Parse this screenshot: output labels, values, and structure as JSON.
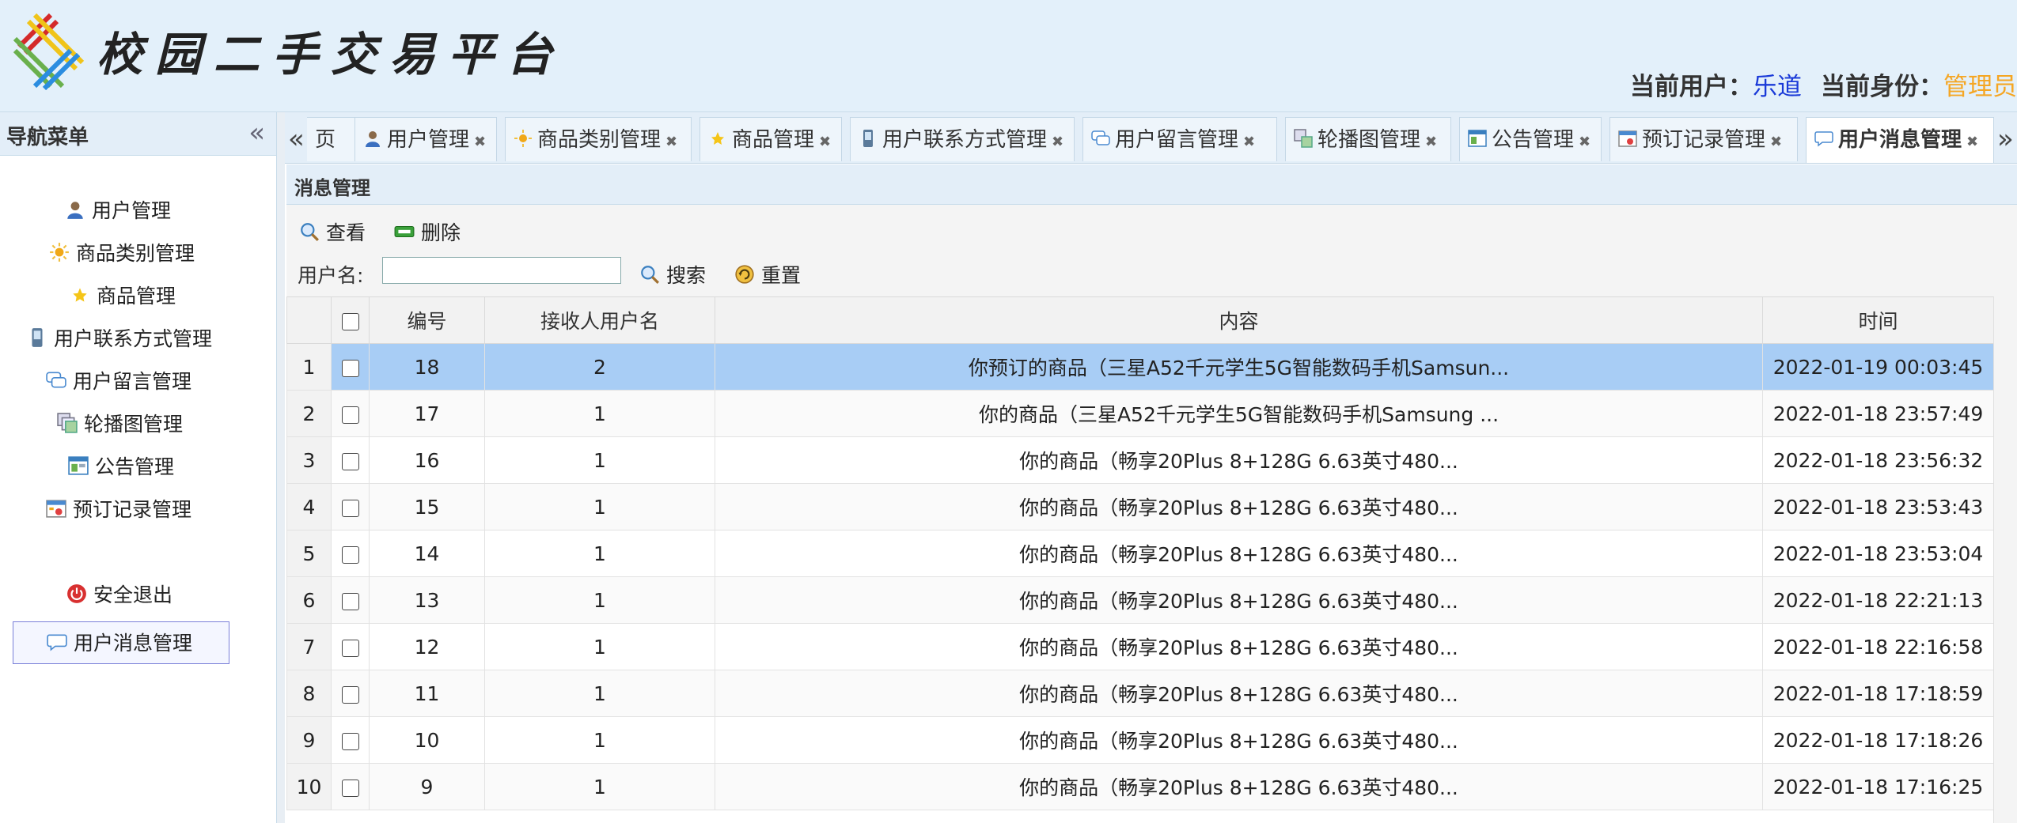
{
  "header": {
    "site_title": "校园二手交易平台",
    "current_user_label": "当前用户：",
    "current_user": "乐道",
    "current_role_label": "当前身份：",
    "current_role": "管理员"
  },
  "sidebar": {
    "title": "导航菜单",
    "items": [
      {
        "label": "用户管理",
        "icon": "user-icon"
      },
      {
        "label": "商品类别管理",
        "icon": "sun-icon"
      },
      {
        "label": "商品管理",
        "icon": "star-icon"
      },
      {
        "label": "用户联系方式管理",
        "icon": "phone-icon"
      },
      {
        "label": "用户留言管理",
        "icon": "chat-icon"
      },
      {
        "label": "轮播图管理",
        "icon": "images-icon"
      },
      {
        "label": "公告管理",
        "icon": "board-icon"
      },
      {
        "label": "预订记录管理",
        "icon": "calendar-icon"
      },
      {
        "label": "用户消息管理",
        "icon": "message-icon"
      },
      {
        "label": "安全退出",
        "icon": "power-icon"
      }
    ]
  },
  "tabs": [
    {
      "label": "页"
    },
    {
      "label": "用户管理"
    },
    {
      "label": "商品类别管理"
    },
    {
      "label": "商品管理"
    },
    {
      "label": "用户联系方式管理"
    },
    {
      "label": "用户留言管理"
    },
    {
      "label": "轮播图管理"
    },
    {
      "label": "公告管理"
    },
    {
      "label": "预订记录管理"
    },
    {
      "label": "用户消息管理"
    }
  ],
  "panel": {
    "title": "消息管理",
    "view_label": "查看",
    "delete_label": "删除",
    "username_label": "用户名:",
    "username_value": "",
    "search_label": "搜索",
    "reset_label": "重置"
  },
  "table": {
    "columns": [
      "编号",
      "接收人用户名",
      "内容",
      "时间"
    ],
    "rows": [
      {
        "n": "1",
        "id": "18",
        "receiver": "2",
        "content": "你预订的商品（三星A52千元学生5G智能数码手机Samsun...",
        "time": "2022-01-19 00:03:45"
      },
      {
        "n": "2",
        "id": "17",
        "receiver": "1",
        "content": "你的商品（三星A52千元学生5G智能数码手机Samsung ...",
        "time": "2022-01-18 23:57:49"
      },
      {
        "n": "3",
        "id": "16",
        "receiver": "1",
        "content": "你的商品（畅享20Plus 8+128G 6.63英寸480...",
        "time": "2022-01-18 23:56:32"
      },
      {
        "n": "4",
        "id": "15",
        "receiver": "1",
        "content": "你的商品（畅享20Plus 8+128G 6.63英寸480...",
        "time": "2022-01-18 23:53:43"
      },
      {
        "n": "5",
        "id": "14",
        "receiver": "1",
        "content": "你的商品（畅享20Plus 8+128G 6.63英寸480...",
        "time": "2022-01-18 23:53:04"
      },
      {
        "n": "6",
        "id": "13",
        "receiver": "1",
        "content": "你的商品（畅享20Plus 8+128G 6.63英寸480...",
        "time": "2022-01-18 22:21:13"
      },
      {
        "n": "7",
        "id": "12",
        "receiver": "1",
        "content": "你的商品（畅享20Plus 8+128G 6.63英寸480...",
        "time": "2022-01-18 22:16:58"
      },
      {
        "n": "8",
        "id": "11",
        "receiver": "1",
        "content": "你的商品（畅享20Plus 8+128G 6.63英寸480...",
        "time": "2022-01-18 17:18:59"
      },
      {
        "n": "9",
        "id": "10",
        "receiver": "1",
        "content": "你的商品（畅享20Plus 8+128G 6.63英寸480...",
        "time": "2022-01-18 17:18:26"
      },
      {
        "n": "10",
        "id": "9",
        "receiver": "1",
        "content": "你的商品（畅享20Plus 8+128G 6.63英寸480...",
        "time": "2022-01-18 17:16:25"
      }
    ]
  },
  "colors": {
    "header_bg": "#e3f0fa",
    "username_color": "#1a3ad8",
    "role_color": "#f5a623",
    "selected_row": "#a8cdf5"
  }
}
